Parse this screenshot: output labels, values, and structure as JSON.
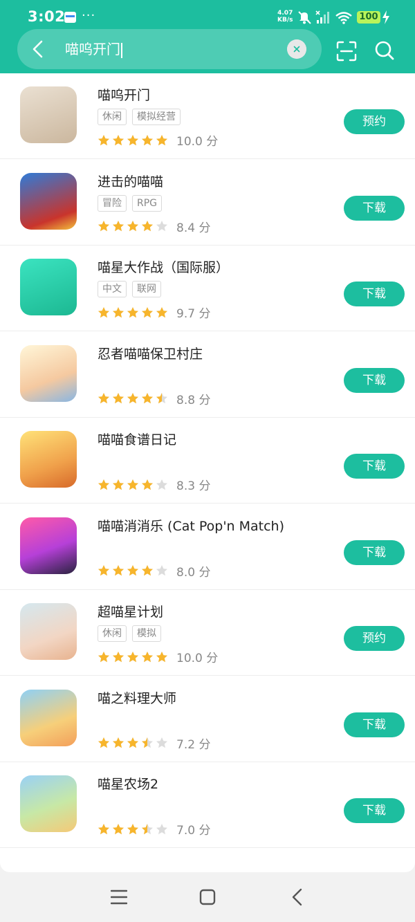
{
  "status_bar": {
    "time": "3:02",
    "dots": "···",
    "speed_value": "4.07",
    "speed_unit": "KB/s",
    "battery": "100"
  },
  "search": {
    "query": "喵呜开门",
    "back_icon": "back-arrow-icon",
    "clear_icon": "clear-icon",
    "scan_icon": "scan-icon",
    "search_icon": "search-icon"
  },
  "colors": {
    "accent": "#1dbe9f",
    "star": "#f7b52c",
    "star_empty": "#dcdcdc"
  },
  "apps": [
    {
      "name": "喵呜开门",
      "tags": [
        "休闲",
        "模拟经营"
      ],
      "stars": 5,
      "score": "10.0 分",
      "action": "预约"
    },
    {
      "name": "进击的喵喵",
      "tags": [
        "冒险",
        "RPG"
      ],
      "stars": 4,
      "score": "8.4 分",
      "action": "下载"
    },
    {
      "name": "喵星大作战（国际服）",
      "tags": [
        "中文",
        "联网"
      ],
      "stars": 5,
      "score": "9.7 分",
      "action": "下载"
    },
    {
      "name": "忍者喵喵保卫村庄",
      "tags": [],
      "stars": 4.5,
      "score": "8.8 分",
      "action": "下载"
    },
    {
      "name": "喵喵食谱日记",
      "tags": [],
      "stars": 4,
      "score": "8.3 分",
      "action": "下载"
    },
    {
      "name": "喵喵消消乐 (Cat Pop'n Match)",
      "tags": [],
      "stars": 4,
      "score": "8.0 分",
      "action": "下载"
    },
    {
      "name": "超喵星计划",
      "tags": [
        "休闲",
        "模拟"
      ],
      "stars": 5,
      "score": "10.0 分",
      "action": "预约"
    },
    {
      "name": "喵之料理大师",
      "tags": [],
      "stars": 3.5,
      "score": "7.2 分",
      "action": "下载"
    },
    {
      "name": "喵星农场2",
      "tags": [],
      "stars": 3.5,
      "score": "7.0 分",
      "action": "下载"
    }
  ],
  "nav": {
    "menu_icon": "menu-icon",
    "home_icon": "home-icon",
    "back_icon": "back-icon"
  }
}
